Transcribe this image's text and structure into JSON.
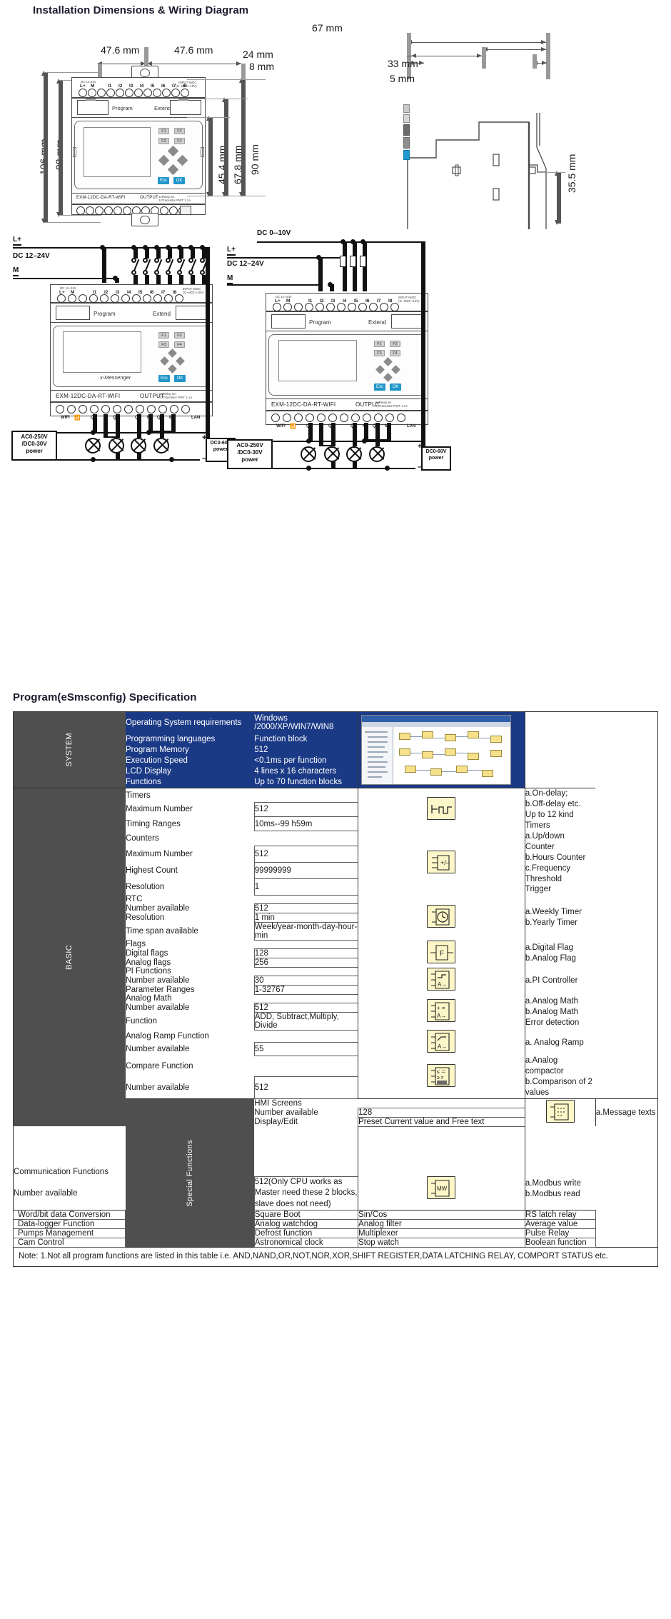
{
  "headings": {
    "install": "Installation Dimensions & Wiring Diagram",
    "program": "Program(eSmsconfig) Specification"
  },
  "dimensions": {
    "front": {
      "width_left": "47.6 mm",
      "width_right": "47.6 mm",
      "height_total": "106 mm",
      "height_body": "98 mm",
      "h_45": "45.4 mm",
      "h_67": "67.8 mm",
      "h_90": "90 mm"
    },
    "side": {
      "d_24": "24 mm",
      "d_8": "8 mm",
      "d_67": "67 mm",
      "d_33": "33 mm",
      "d_5": "5 mm",
      "d_355": "35.5 mm"
    }
  },
  "device": {
    "model": "EXM-12DC-DA-RT-WIFI",
    "brand": "x-Messenger",
    "supply_note": "DC 12-24V",
    "input_label": "INPUT 8xDC",
    "input_sub": "(I1~I4DC~10V)",
    "output_label": "OUTPUT",
    "output_sub1": "1xRelay  8A",
    "output_sub2": "2xTransistor PWT 1.1A",
    "program_slot": "Program",
    "extend_slot": "Extend",
    "input_terminals": [
      "L+",
      "M",
      "I1",
      "I2",
      "I3",
      "I4",
      "I5",
      "I6",
      "I7",
      "I8"
    ],
    "output_terminals": [
      "WIFI",
      "Q1",
      "Q2",
      "Q3",
      "M",
      "Q4",
      "M",
      "LAN"
    ],
    "relay_pins": [
      "1",
      "2"
    ],
    "function_keys": [
      "F1",
      "F2",
      "F3",
      "F4"
    ],
    "esc_key": "Esc",
    "ok_key": "OK"
  },
  "wiring": {
    "left": {
      "rail_pos": "L+",
      "supply": "DC  12–24V",
      "rail_neg": "M",
      "power_box": "AC0-250V\n/DC0-30V\npower",
      "power_box_l1": "AC0-250V",
      "power_box_l2": "/DC0-30V",
      "power_box_l3": "power",
      "load_box_l1": "DC0-60V",
      "load_box_l2": "power",
      "load_box_plus": "+",
      "load_box_minus": "–"
    },
    "right": {
      "analog_label": "DC 0--10V",
      "rail_pos": "L+",
      "supply": "DC  12–24V",
      "rail_neg": "M",
      "power_box_l1": "AC0-250V",
      "power_box_l2": "/DC0-30V",
      "power_box_l3": "power",
      "load_box_l1": "DC0-60V",
      "load_box_l2": "power",
      "load_box_plus": "+",
      "load_box_minus": "–"
    }
  },
  "spec": {
    "groups": {
      "system": "SYSTEM",
      "basic": "BASIC",
      "special": "Special Functions"
    },
    "system_rows": [
      {
        "key": "Operating System requirements",
        "value": "Windows /2000/XP/WIN7/WIN8"
      },
      {
        "key": "Programming languages",
        "value": "Function block"
      },
      {
        "key": "Program Memory",
        "value": "512"
      },
      {
        "key": "Execution Speed",
        "value": "<0.1ms per function"
      },
      {
        "key": "LCD Display",
        "value": "4 lines x 16 characters"
      },
      {
        "key": "Functions",
        "value": "Up to 70 function blocks"
      }
    ],
    "basic_blocks": [
      {
        "icon": "timer-icon",
        "rows": [
          {
            "key": "Timers",
            "value": "",
            "boxed": false
          },
          {
            "key": "Maximum Number",
            "value": "512",
            "boxed": true
          },
          {
            "key": "Timing Ranges",
            "value": "10ms--99 h59m",
            "boxed": true
          }
        ],
        "desc": [
          "a.On-delay;",
          "b.Off-delay etc.",
          "Up to 12 kind Timers"
        ]
      },
      {
        "icon": "counter-icon",
        "rows": [
          {
            "key": "Counters",
            "value": "",
            "boxed": false
          },
          {
            "key": "Maximum Number",
            "value": "512",
            "boxed": true
          },
          {
            "key": "Highest Count",
            "value": "99999999",
            "boxed": true
          },
          {
            "key": "Resolution",
            "value": "1",
            "boxed": true
          }
        ],
        "desc": [
          "a.Up/down Counter",
          "b.Hours Counter",
          "c.Frequency Threshold",
          "    Trigger"
        ]
      },
      {
        "icon": "clock-icon",
        "rows": [
          {
            "key": "RTC",
            "value": "",
            "boxed": false
          },
          {
            "key": "Number available",
            "value": "512",
            "boxed": true
          },
          {
            "key": "Resolution",
            "value": "1 min",
            "boxed": true
          },
          {
            "key": "Time span available",
            "value": "Week/year-month-day-hour-min",
            "boxed": true
          }
        ],
        "desc": [
          "a.Weekly Timer",
          "b.Yearly Timer"
        ]
      },
      {
        "icon": "flag-icon",
        "rows": [
          {
            "key": "Flags",
            "value": "",
            "boxed": false
          },
          {
            "key": "Digital flags",
            "value": "128",
            "boxed": true
          },
          {
            "key": "Analog flags",
            "value": "256",
            "boxed": true
          }
        ],
        "desc": [
          "a.Digital Flag",
          "b.Analog Flag"
        ]
      },
      {
        "icon": "pi-controller-icon",
        "rows": [
          {
            "key": "PI Functions",
            "value": "",
            "boxed": false
          },
          {
            "key": "Number available",
            "value": "30",
            "boxed": true
          },
          {
            "key": "Parameter Ranges",
            "value": "1-32767",
            "boxed": true
          }
        ],
        "desc": [
          "a.PI Controller"
        ]
      },
      {
        "icon": "analog-math-icon",
        "rows": [
          {
            "key": "Analog Math",
            "value": "",
            "boxed": false
          },
          {
            "key": "Number available",
            "value": "512",
            "boxed": true
          },
          {
            "key": "Function",
            "value": "ADD, Subtract,Multiply, Divide",
            "boxed": true
          }
        ],
        "desc": [
          "a.Analog Math",
          "b.Analog Math",
          "    Error detection"
        ]
      },
      {
        "icon": "analog-ramp-icon",
        "rows": [
          {
            "key": "Analog Ramp Function",
            "value": "",
            "boxed": false
          },
          {
            "key": "Number available",
            "value": "55",
            "boxed": true
          }
        ],
        "desc": [
          "a. Analog Ramp"
        ]
      },
      {
        "icon": "compare-icon",
        "rows": [
          {
            "key": "Compare Function",
            "value": "",
            "boxed": false
          },
          {
            "key": "Number available",
            "value": "512",
            "boxed": true
          }
        ],
        "desc": [
          "a.Analog compactor",
          "b.Comparison of 2 values"
        ]
      }
    ],
    "special_blocks": [
      {
        "icon": "hmi-icon",
        "rows": [
          {
            "key": "HMI Screens",
            "value": "",
            "boxed": false
          },
          {
            "key": "Number available",
            "value": "128",
            "boxed": true
          },
          {
            "key": "Display/Edit",
            "value": "Preset Current value and Free text",
            "boxed": true
          }
        ],
        "desc": [
          "a.Message texts"
        ]
      },
      {
        "icon": "modbus-icon",
        "rows": [
          {
            "key": "Communication Functions",
            "value": "",
            "boxed": false
          },
          {
            "key": "Number available",
            "value": "512(Only CPU works as Master need\nthese 2 blocks, slave does not need)",
            "boxed": true
          }
        ],
        "desc": [
          "a.Modbus write",
          "b.Modbus read"
        ]
      }
    ],
    "matrix_rows": [
      [
        "Word/bit data Conversion",
        "Square Boot",
        "Sin/Cos",
        "RS latch relay"
      ],
      [
        "Data-logger Function",
        "Analog watchdog",
        "Analog filter",
        "Average value"
      ],
      [
        "Pumps Management",
        "Defrost function",
        "Multiplexer",
        "Pulse Relay"
      ],
      [
        "Cam Control",
        "Astronomical clock",
        "Stop watch",
        "Boolean function"
      ]
    ],
    "note": "Note: 1.Not all program functions are listed in this table i.e. AND,NAND,OR,NOT,NOR,XOR,SHIFT REGISTER,DATA LATCHING RELAY, COMPORT STATUS etc."
  },
  "colors": {
    "header_blue": "#1b3a86",
    "group_gray": "#4f4f4f",
    "accent_blue": "#2196c9",
    "icon_yellow": "#fdf6c8"
  }
}
